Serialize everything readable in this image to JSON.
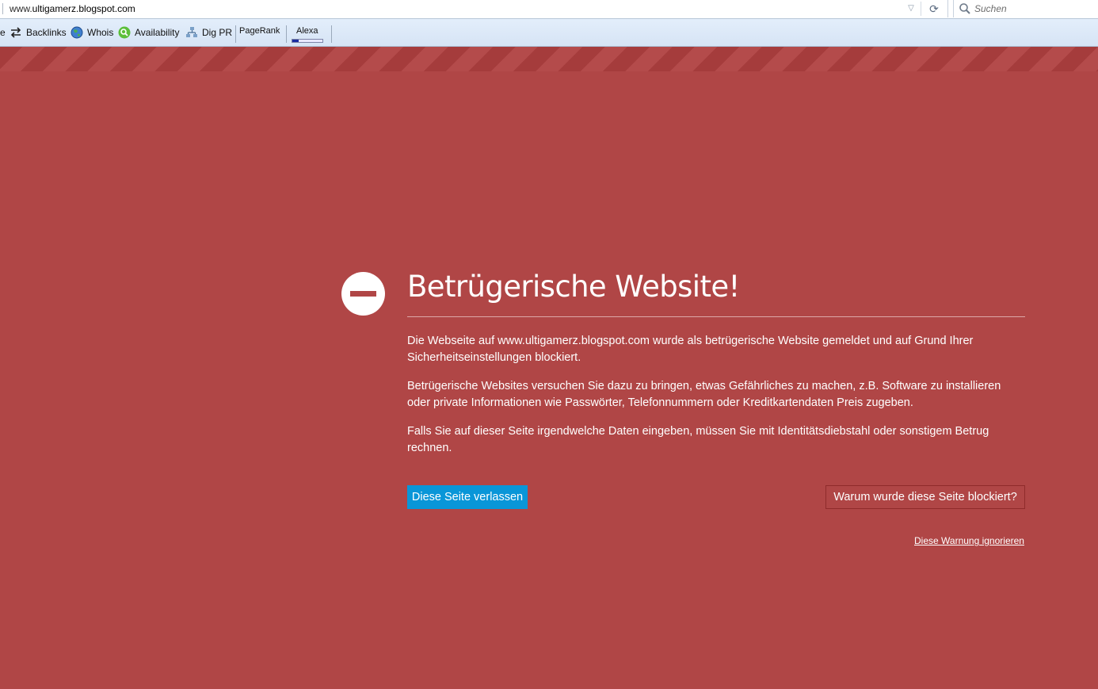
{
  "browser": {
    "address": {
      "prefix": "www.",
      "domain": "ultigamerz.blogspot.com"
    },
    "search": {
      "placeholder": "Suchen"
    }
  },
  "toolbar": {
    "items": [
      {
        "label": "e",
        "icon": "truncated-icon"
      },
      {
        "label": "Backlinks",
        "icon": "arrows-exchange-icon"
      },
      {
        "label": "Whois",
        "icon": "globe-icon"
      },
      {
        "label": "Availability",
        "icon": "magnifier-green-icon"
      },
      {
        "label": "Dig PR",
        "icon": "network-icon"
      }
    ],
    "pagerank_label": "PageRank",
    "alexa_label": "Alexa",
    "alexa_level": 0.2
  },
  "warning": {
    "title": "Betrügerische Website!",
    "paragraphs": [
      "Die Webseite auf www.ultigamerz.blogspot.com wurde als betrügerische Website gemeldet und auf Grund Ihrer Sicherheitseinstellungen blockiert.",
      "Betrügerische Websites versuchen Sie dazu zu bringen, etwas Gefährliches zu machen, z.B. Software zu installieren oder private Informationen wie Passwörter, Telefonnummern oder Kreditkartendaten Preis zugeben.",
      "Falls Sie auf dieser Seite irgendwelche Daten eingeben, müssen Sie mit Identitätsdiebstahl oder sonstigem Betrug rechnen."
    ],
    "leave_button": "Diese Seite verlassen",
    "why_button": "Warum wurde diese Seite blockiert?",
    "ignore_link": "Diese Warnung ignorieren"
  },
  "colors": {
    "background": "#b04646",
    "leave_button": "#0996d8"
  }
}
